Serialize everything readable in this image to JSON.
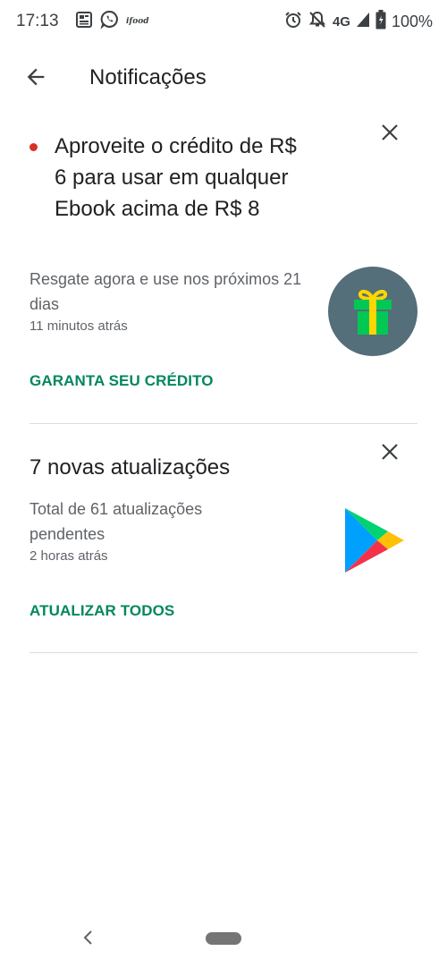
{
  "status_bar": {
    "time": "17:13",
    "left_icons": [
      "news-icon",
      "whatsapp-icon",
      "ifood-icon"
    ],
    "ifood_label": "ifood",
    "right_icons": [
      "alarm-icon",
      "notifications-off-icon",
      "signal-icon",
      "battery-icon"
    ],
    "network": "4G",
    "battery_percent": "100%"
  },
  "header": {
    "back_icon": "arrow-back-icon",
    "title": "Notificações"
  },
  "notifications": [
    {
      "unread": true,
      "title": "Aproveite o crédito de R$ 6 para usar em qualquer Ebook acima de R$ 8",
      "body": "Resgate agora e use nos próximos 21 dias",
      "time": "11 minutos atrás",
      "action": "GARANTA SEU CRÉDITO",
      "icon": "gift-icon",
      "icon_bg": "#546e7a",
      "icon_color": "#00c853"
    },
    {
      "unread": false,
      "title": "7 novas atualizações",
      "body": "Total de 61 atualizações pendentes",
      "time": "2 horas atrás",
      "action": "ATUALIZAR TODOS",
      "icon": "google-play-icon"
    }
  ],
  "colors": {
    "accent": "#01875f",
    "unread_dot": "#d93025",
    "divider": "#dadce0"
  },
  "nav_bar": {
    "back_icon": "nav-back-icon",
    "home": "nav-home-pill"
  }
}
